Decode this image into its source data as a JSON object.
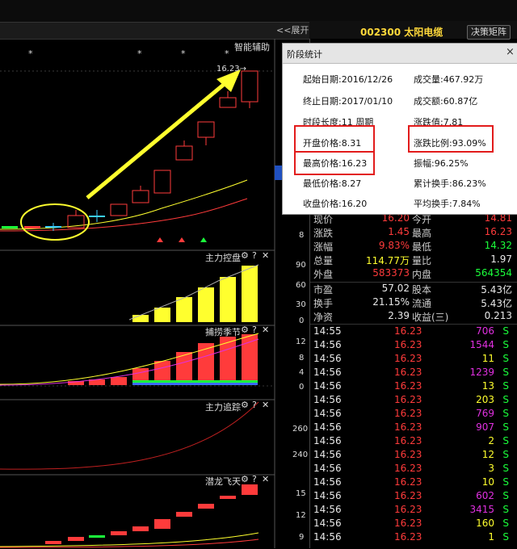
{
  "toolbar": {
    "expand_label": "<<展开",
    "stock_code_name": "002300 太阳电缆",
    "matrix_button": "决策矩阵"
  },
  "main_chart": {
    "label": "智能辅助",
    "star": "*",
    "price_peak_label": "16.23→",
    "axis_value": "8"
  },
  "panes": [
    {
      "label": "主力控盘",
      "axis": [
        "90",
        "60",
        "30",
        "0"
      ]
    },
    {
      "label": "捕捞季节",
      "axis": [
        "12",
        "8",
        "4",
        "0"
      ]
    },
    {
      "label": "主力追踪",
      "axis": [
        "260",
        "240"
      ]
    },
    {
      "label": "潜龙飞天",
      "axis": [
        "15",
        "12",
        "9"
      ]
    }
  ],
  "pane_icons": {
    "gear": "⚙",
    "help": "?",
    "close": "✕"
  },
  "stats": {
    "title": "阶段统计",
    "close": "×",
    "start_date": "起始日期:2016/12/26",
    "end_date": "终止日期:2017/01/10",
    "period": "时段长度:11 周期",
    "open_price": "开盘价格:8.31",
    "high_price": "最高价格:16.23",
    "low_price": "最低价格:8.27",
    "close_price": "收盘价格:16.20",
    "volume": "成交量:467.92万",
    "amount": "成交额:60.87亿",
    "change_value": "涨跌值:7.81",
    "change_ratio": "涨跌比例:93.09%",
    "amplitude": "振幅:96.25%",
    "cum_turnover": "累计换手:86.23%",
    "avg_turnover": "平均换手:7.84%"
  },
  "quote": [
    {
      "l1": "现价",
      "v1": "16.20",
      "c1": "red",
      "l2": "今开",
      "v2": "14.81",
      "c2": "red"
    },
    {
      "l1": "涨跌",
      "v1": "1.45",
      "c1": "red",
      "l2": "最高",
      "v2": "16.23",
      "c2": "red"
    },
    {
      "l1": "涨幅",
      "v1": "9.83%",
      "c1": "red",
      "l2": "最低",
      "v2": "14.32",
      "c2": "green"
    },
    {
      "l1": "总量",
      "v1": "114.77万",
      "c1": "yellow",
      "l2": "量比",
      "v2": "1.97",
      "c2": "white"
    },
    {
      "l1": "外盘",
      "v1": "583373",
      "c1": "red",
      "l2": "内盘",
      "v2": "564354",
      "c2": "green"
    },
    {
      "l1": "市盈",
      "v1": "57.02",
      "c1": "white",
      "l2": "股本",
      "v2": "5.43亿",
      "c2": "white"
    },
    {
      "l1": "换手",
      "v1": "21.15%",
      "c1": "white",
      "l2": "流通",
      "v2": "5.43亿",
      "c2": "white"
    },
    {
      "l1": "净资",
      "v1": "2.39",
      "c1": "white",
      "l2": "收益(三)",
      "v2": "0.213",
      "c2": "white"
    }
  ],
  "ticks": [
    {
      "time": "14:55",
      "price": "16.23",
      "vol": "706",
      "c": "magenta",
      "side": "S"
    },
    {
      "time": "14:56",
      "price": "16.23",
      "vol": "1544",
      "c": "magenta",
      "side": "S"
    },
    {
      "time": "14:56",
      "price": "16.23",
      "vol": "11",
      "c": "yellow",
      "side": "S"
    },
    {
      "time": "14:56",
      "price": "16.23",
      "vol": "1239",
      "c": "magenta",
      "side": "S"
    },
    {
      "time": "14:56",
      "price": "16.23",
      "vol": "13",
      "c": "yellow",
      "side": "S"
    },
    {
      "time": "14:56",
      "price": "16.23",
      "vol": "203",
      "c": "yellow",
      "side": "S"
    },
    {
      "time": "14:56",
      "price": "16.23",
      "vol": "769",
      "c": "magenta",
      "side": "S"
    },
    {
      "time": "14:56",
      "price": "16.23",
      "vol": "907",
      "c": "magenta",
      "side": "S"
    },
    {
      "time": "14:56",
      "price": "16.23",
      "vol": "2",
      "c": "yellow",
      "side": "S"
    },
    {
      "time": "14:56",
      "price": "16.23",
      "vol": "12",
      "c": "yellow",
      "side": "S"
    },
    {
      "time": "14:56",
      "price": "16.23",
      "vol": "3",
      "c": "yellow",
      "side": "S"
    },
    {
      "time": "14:56",
      "price": "16.23",
      "vol": "10",
      "c": "yellow",
      "side": "S"
    },
    {
      "time": "14:56",
      "price": "16.23",
      "vol": "602",
      "c": "magenta",
      "side": "S"
    },
    {
      "time": "14:56",
      "price": "16.23",
      "vol": "3415",
      "c": "magenta",
      "side": "S"
    },
    {
      "time": "14:56",
      "price": "16.23",
      "vol": "160",
      "c": "yellow",
      "side": "S"
    },
    {
      "time": "14:56",
      "price": "16.23",
      "vol": "1",
      "c": "yellow",
      "side": "S"
    }
  ],
  "colors": {
    "up": "#ff3b3b",
    "down": "#1bff3b",
    "accent": "#ffff2e",
    "highlight": "#e21b1b"
  }
}
